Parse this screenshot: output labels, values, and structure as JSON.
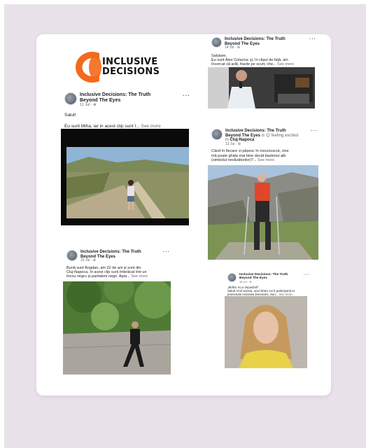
{
  "logo": {
    "line1": "INCLUSIVE",
    "line2": "DECISIONS",
    "accent": "#f26a1b"
  },
  "posts": [
    {
      "author": "Inclusive Decisions: The Truth Beyond The Eyes",
      "time": "11 Jul · ⊕",
      "lines": [
        "Salut!",
        "Eu sunt Miha, iar in acest clip sunt î..."
      ],
      "see_more": "See more"
    },
    {
      "author": "Inclusive Decisions: The Truth Beyond The Eyes",
      "time": "14 Jul · ⊕",
      "lines": [
        "Salutare,",
        "Eu sunt Alex Cotaciuc și, în clipul de față, am",
        "încercat să arăt, foarte pe scurt, che..."
      ],
      "see_more": "See more"
    },
    {
      "author": "Inclusive Decisions: The Truth Beyond The Eyes",
      "feeling": "is 😊 feeling excited in",
      "place": "Cluj-Napoca",
      "time": "13 Jul · ⊕",
      "lines": [
        "Când în fiecare zi pășesc în necunoscut, cine",
        "mă poate ghida mai bine decât bastonul alb",
        "(simbolul nevăzătorilor)?..."
      ],
      "see_more": "See more"
    },
    {
      "author": "Inclusive Decisions: The Truth Beyond The Eyes",
      "time": "16 Jul · ⊕",
      "lines": [
        "Bună sunt Bogdan, am 22 de ani și sunt din",
        "Cluj-Napoca, în acest clip sunt îmbrăcat într-un",
        "tricou negru și pantaloni negri. Apar..."
      ],
      "see_more": "See more"
    },
    {
      "author": "Inclusive Decisions: The Truth Beyond The Eyes",
      "time": "18 Jul · ⊕",
      "lines": [
        "„Birthic nu e imposibil!\"",
        "Salut! Anul acesta, unul dintre cei 5 participanți ai",
        "proiectului Inclusive Decisions, Sun..."
      ],
      "see_more": "See more"
    }
  ],
  "more_icon": "more-options-icon"
}
